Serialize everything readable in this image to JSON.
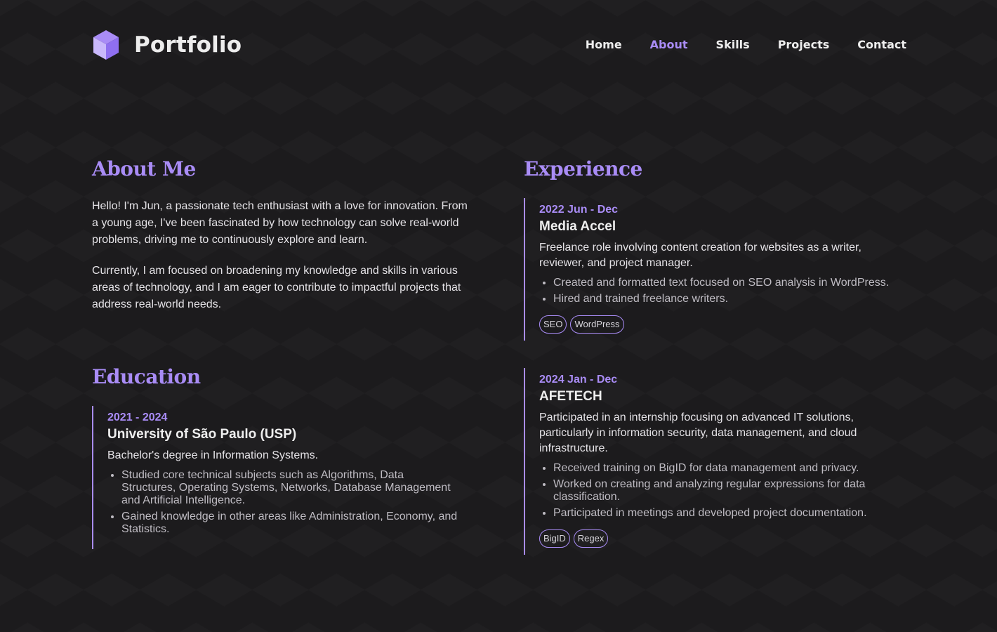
{
  "header": {
    "brand": "Portfolio",
    "logo_icon": "cube-icon",
    "nav": [
      {
        "label": "Home",
        "active": false
      },
      {
        "label": "About",
        "active": true
      },
      {
        "label": "Skills",
        "active": false
      },
      {
        "label": "Projects",
        "active": false
      },
      {
        "label": "Contact",
        "active": false
      }
    ]
  },
  "about": {
    "title": "About Me",
    "paragraphs": [
      "Hello! I'm Jun, a passionate tech enthusiast with a love for innovation. From a young age, I've been fascinated by how technology can solve real-world problems, driving me to continuously explore and learn.",
      "Currently, I am focused on broadening my knowledge and skills in various areas of technology, and I am eager to contribute to impactful projects that address real-world needs."
    ]
  },
  "education": {
    "title": "Education",
    "entries": [
      {
        "date": "2021 - 2024",
        "org": "University of São Paulo (USP)",
        "desc": "Bachelor's degree in Information Systems.",
        "bullets": [
          "Studied core technical subjects such as Algorithms, Data Structures, Operating Systems, Networks, Database Management and Artificial Intelligence.",
          "Gained knowledge in other areas like Administration, Economy, and Statistics."
        ]
      }
    ]
  },
  "experience": {
    "title": "Experience",
    "entries": [
      {
        "date": "2022 Jun - Dec",
        "org": "Media Accel",
        "desc": "Freelance role involving content creation for websites as a writer, reviewer, and project manager.",
        "bullets": [
          "Created and formatted text focused on SEO analysis in WordPress.",
          "Hired and trained freelance writers."
        ],
        "tags": [
          "SEO",
          "WordPress"
        ]
      },
      {
        "date": "2024 Jan - Dec",
        "org": "AFETECH",
        "desc": "Participated in an internship focusing on advanced IT solutions, particularly in information security, data management, and cloud infrastructure.",
        "bullets": [
          "Received training on BigID for data management and privacy.",
          "Worked on creating and analyzing regular expressions for data classification.",
          "Participated in meetings and developed project documentation."
        ],
        "tags": [
          "BigID",
          "Regex"
        ]
      }
    ]
  },
  "colors": {
    "accent": "#a98cf6",
    "background": "#1c1b1d",
    "text": "#e4e2e6"
  }
}
